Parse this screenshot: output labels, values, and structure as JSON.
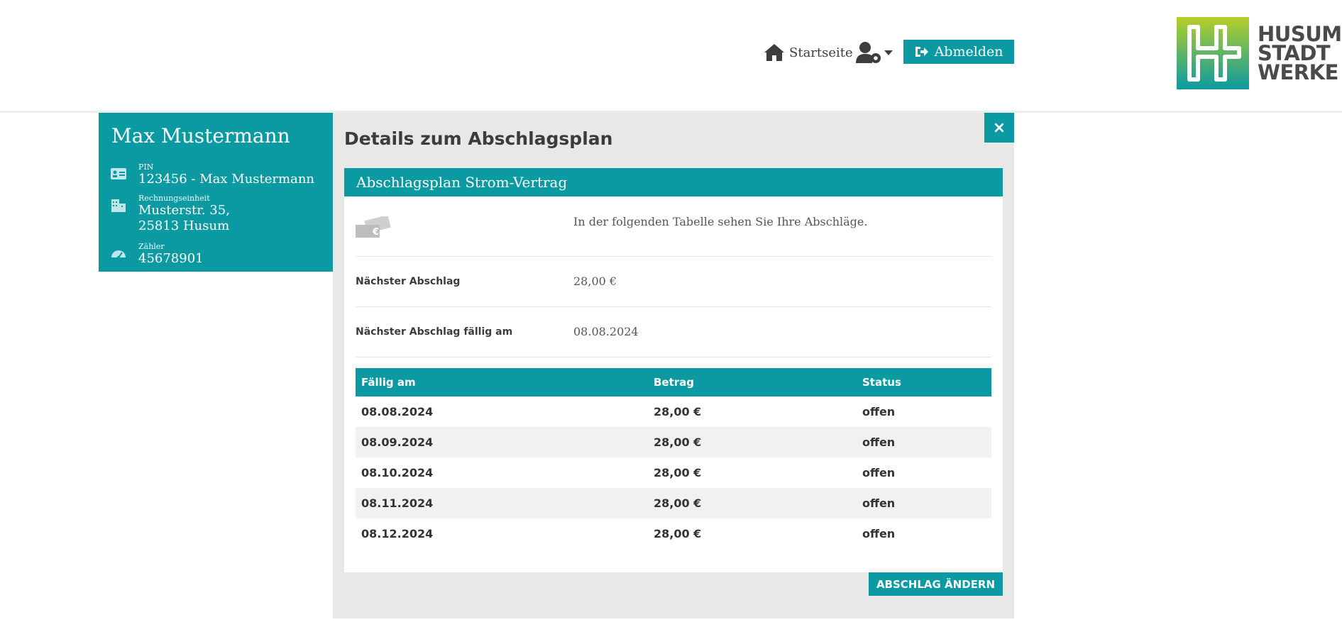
{
  "header": {
    "home_label": "Startseite",
    "logout_label": "Abmelden",
    "logo_lines": [
      "HUSUM",
      "STADT",
      "WERKE"
    ]
  },
  "customer": {
    "name": "Max Mustermann",
    "pin_label": "PIN",
    "pin_value": "123456 - Max Mustermann",
    "unit_label": "Rechnungseinheit",
    "unit_line1": "Musterstr. 35,",
    "unit_line2": "25813 Husum",
    "meter_label": "Zähler",
    "meter_value": "45678901"
  },
  "panel": {
    "title": "Details zum Abschlagsplan",
    "close": "×",
    "box_title": "Abschlagsplan Strom-Vertrag",
    "intro": "In der folgenden Tabelle sehen Sie Ihre Abschläge.",
    "next_label": "Nächster Abschlag",
    "next_value": "28,00 €",
    "due_label": "Nächster Abschlag fällig am",
    "due_value": "08.08.2024",
    "table": {
      "headers": [
        "Fällig am",
        "Betrag",
        "Status"
      ],
      "rows": [
        [
          "08.08.2024",
          "28,00 €",
          "offen"
        ],
        [
          "08.09.2024",
          "28,00 €",
          "offen"
        ],
        [
          "08.10.2024",
          "28,00 €",
          "offen"
        ],
        [
          "08.11.2024",
          "28,00 €",
          "offen"
        ],
        [
          "08.12.2024",
          "28,00 €",
          "offen"
        ]
      ]
    },
    "change_button": "ABSCHLAG ÄNDERN"
  },
  "colors": {
    "accent": "#0b9aa2",
    "panel_bg": "#e8e8e8",
    "text": "#3c3c3c"
  }
}
